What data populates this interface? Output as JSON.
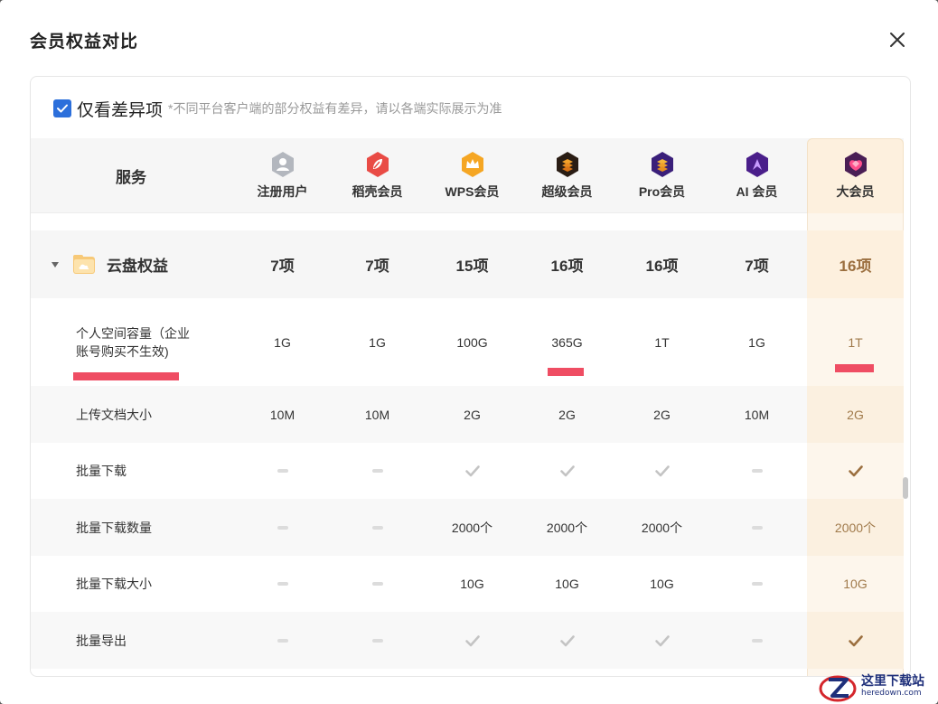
{
  "dialog": {
    "title": "会员权益对比",
    "close_icon": "close-icon"
  },
  "filter": {
    "checked": true,
    "label": "仅看差异项",
    "note": "*不同平台客户端的部分权益有差异，请以各端实际展示为准"
  },
  "table": {
    "service_header": "服务",
    "tiers": [
      {
        "label": "注册用户",
        "icon": "user-icon",
        "color": "#a9adb5"
      },
      {
        "label": "稻壳会员",
        "icon": "leaf-icon",
        "color": "#e94b45"
      },
      {
        "label": "WPS会员",
        "icon": "crown-icon",
        "color": "#f3a12a"
      },
      {
        "label": "超级会员",
        "icon": "layers-icon",
        "color": "#2a1d14"
      },
      {
        "label": "Pro会员",
        "icon": "layers-icon",
        "color": "#3a1f7a"
      },
      {
        "label": "AI 会员",
        "icon": "ai-icon",
        "color": "#4a1e8a"
      },
      {
        "label": "大会员",
        "icon": "diamond-icon",
        "color": "#4a1e55"
      }
    ],
    "group": {
      "title": "云盘权益",
      "icon": "cloud-folder-icon",
      "counts": [
        "7项",
        "7项",
        "15项",
        "16项",
        "16项",
        "7项",
        "16项"
      ]
    },
    "rows": [
      {
        "label": "个人空间容量（企业账号购买不生效)",
        "values": [
          "1G",
          "1G",
          "100G",
          "365G",
          "1T",
          "1G",
          "1T"
        ]
      },
      {
        "label": "上传文档大小",
        "values": [
          "10M",
          "10M",
          "2G",
          "2G",
          "2G",
          "10M",
          "2G"
        ]
      },
      {
        "label": "批量下载",
        "values": [
          "-",
          "-",
          "✓",
          "✓",
          "✓",
          "-",
          "✓"
        ]
      },
      {
        "label": "批量下载数量",
        "values": [
          "-",
          "-",
          "2000个",
          "2000个",
          "2000个",
          "-",
          "2000个"
        ]
      },
      {
        "label": "批量下载大小",
        "values": [
          "-",
          "-",
          "10G",
          "10G",
          "10G",
          "-",
          "10G"
        ]
      },
      {
        "label": "批量导出",
        "values": [
          "-",
          "-",
          "✓",
          "✓",
          "✓",
          "-",
          "✓"
        ]
      }
    ]
  },
  "colors": {
    "accent": "#2c6fdb",
    "vip_text": "#a07a4b",
    "highlight": "#ef4d63"
  },
  "watermark": {
    "cn": "这里下载站",
    "en": "heredown.com"
  }
}
